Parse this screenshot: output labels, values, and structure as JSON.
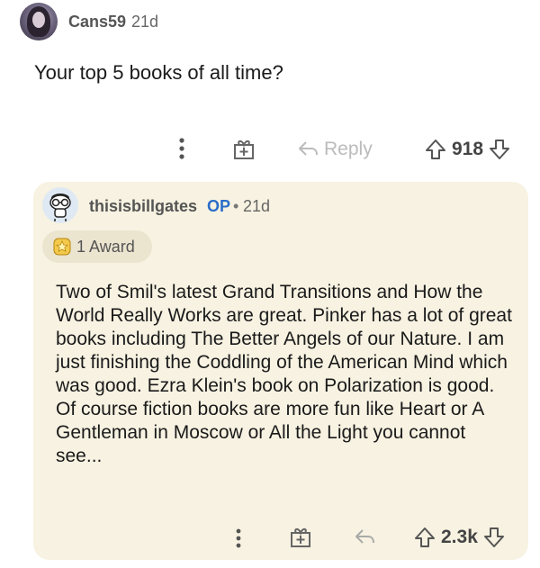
{
  "top_comment": {
    "username": "Cans59",
    "age": "21d",
    "body": "Your top 5 books of all time?",
    "actions": {
      "more_icon": "more-vertical-icon",
      "award_icon": "gift-plus-icon",
      "reply_label": "Reply",
      "score": "918"
    }
  },
  "reply": {
    "username": "thisisbillgates",
    "op_badge": "OP",
    "separator": "•",
    "age": "21d",
    "award_label": "1 Award",
    "body": "Two of Smil's latest Grand Transitions and How the World Really Works are great. Pinker has a lot of great books including The Better Angels of our Nature. I am just finishing the Coddling of the American Mind which was good. Ezra Klein's book on Polarization is good. Of course fiction books are more fun like Heart or A Gentleman in Moscow or All the Light you cannot see...",
    "actions": {
      "score": "2.3k"
    }
  },
  "colors": {
    "reply_background": "#f7f2e1",
    "op_badge": "#2a6ec9",
    "award_pill": "#ebe4cf"
  }
}
